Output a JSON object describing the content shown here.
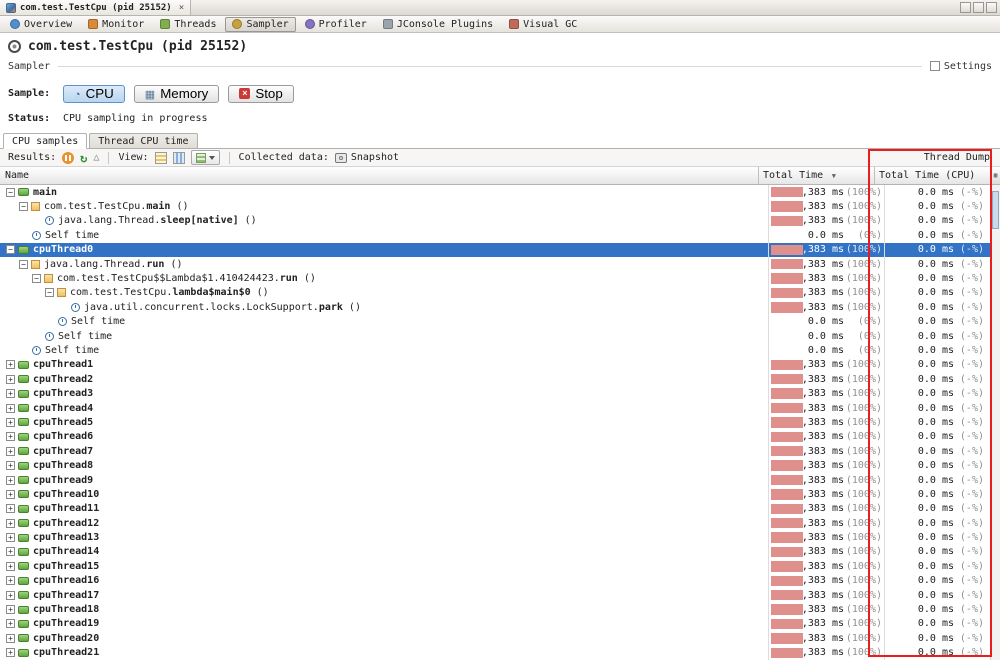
{
  "window": {
    "doc_tab_title": "com.test.TestCpu (pid 25152)",
    "close_symbol": "×"
  },
  "nav_tabs": [
    {
      "label": "Overview",
      "selected": false
    },
    {
      "label": "Monitor",
      "selected": false
    },
    {
      "label": "Threads",
      "selected": false
    },
    {
      "label": "Sampler",
      "selected": true
    },
    {
      "label": "Profiler",
      "selected": false
    },
    {
      "label": "JConsole Plugins",
      "selected": false
    },
    {
      "label": "Visual GC",
      "selected": false
    }
  ],
  "page": {
    "title": "com.test.TestCpu (pid 25152)",
    "section_label": "Sampler",
    "settings_label": "Settings",
    "sample_label": "Sample:",
    "cpu_button": "CPU",
    "memory_button": "Memory",
    "stop_button": "Stop",
    "status_label": "Status:",
    "status_value": "CPU sampling in progress"
  },
  "result_tabs": [
    {
      "label": "CPU samples",
      "selected": true
    },
    {
      "label": "Thread CPU time",
      "selected": false
    }
  ],
  "toolbar": {
    "results_label": "Results:",
    "view_label": "View:",
    "collected_label": "Collected data:",
    "snapshot_label": "Snapshot",
    "thread_dump_label": "Thread Dump",
    "sort_symbol": "▼"
  },
  "table": {
    "columns": {
      "name": "Name",
      "total": "Total Time",
      "cpu": "Total Time (CPU)"
    },
    "rows": [
      {
        "indent": 0,
        "handle": "minus",
        "icon": "thread",
        "prefix": "",
        "bold": "main",
        "suffix": "",
        "total_ms": "10,383 ms",
        "total_pct": "(100%)",
        "cpu_ms": "0.0 ms",
        "cpu_pct": "(-%)",
        "bar": 100,
        "selected": false
      },
      {
        "indent": 1,
        "handle": "minus",
        "icon": "method",
        "prefix": "com.test.TestCpu.",
        "bold": "main",
        "suffix": " ()",
        "total_ms": "10,383 ms",
        "total_pct": "(100%)",
        "cpu_ms": "0.0 ms",
        "cpu_pct": "(-%)",
        "bar": 100,
        "selected": false
      },
      {
        "indent": 3,
        "handle": "none",
        "icon": "clock",
        "prefix": "java.lang.Thread.",
        "bold": "sleep[native]",
        "suffix": " ()",
        "total_ms": "10,383 ms",
        "total_pct": "(100%)",
        "cpu_ms": "0.0 ms",
        "cpu_pct": "(-%)",
        "bar": 100,
        "selected": false
      },
      {
        "indent": 2,
        "handle": "none",
        "icon": "clock",
        "prefix": "Self time",
        "bold": "",
        "suffix": "",
        "total_ms": "0.0 ms",
        "total_pct": "(0%)",
        "cpu_ms": "0.0 ms",
        "cpu_pct": "(-%)",
        "bar": 0,
        "selected": false
      },
      {
        "indent": 0,
        "handle": "minus",
        "icon": "thread",
        "prefix": "",
        "bold": "cpuThread0",
        "suffix": "",
        "total_ms": "10,383 ms",
        "total_pct": "(100%)",
        "cpu_ms": "0.0 ms",
        "cpu_pct": "(-%)",
        "bar": 100,
        "selected": true
      },
      {
        "indent": 1,
        "handle": "minus",
        "icon": "method",
        "prefix": "java.lang.Thread.",
        "bold": "run",
        "suffix": " ()",
        "total_ms": "10,383 ms",
        "total_pct": "(100%)",
        "cpu_ms": "0.0 ms",
        "cpu_pct": "(-%)",
        "bar": 100,
        "selected": false
      },
      {
        "indent": 2,
        "handle": "minus",
        "icon": "method",
        "prefix": "com.test.TestCpu$$Lambda$1.410424423.",
        "bold": "run",
        "suffix": " ()",
        "total_ms": "10,383 ms",
        "total_pct": "(100%)",
        "cpu_ms": "0.0 ms",
        "cpu_pct": "(-%)",
        "bar": 100,
        "selected": false
      },
      {
        "indent": 3,
        "handle": "minus",
        "icon": "method",
        "prefix": "com.test.TestCpu.",
        "bold": "lambda$main$0",
        "suffix": " ()",
        "total_ms": "10,383 ms",
        "total_pct": "(100%)",
        "cpu_ms": "0.0 ms",
        "cpu_pct": "(-%)",
        "bar": 100,
        "selected": false
      },
      {
        "indent": 5,
        "handle": "none",
        "icon": "clock",
        "prefix": "java.util.concurrent.locks.LockSupport.",
        "bold": "park",
        "suffix": " ()",
        "total_ms": "10,383 ms",
        "total_pct": "(100%)",
        "cpu_ms": "0.0 ms",
        "cpu_pct": "(-%)",
        "bar": 100,
        "selected": false
      },
      {
        "indent": 4,
        "handle": "none",
        "icon": "clock",
        "prefix": "Self time",
        "bold": "",
        "suffix": "",
        "total_ms": "0.0 ms",
        "total_pct": "(0%)",
        "cpu_ms": "0.0 ms",
        "cpu_pct": "(-%)",
        "bar": 0,
        "selected": false
      },
      {
        "indent": 3,
        "handle": "none",
        "icon": "clock",
        "prefix": "Self time",
        "bold": "",
        "suffix": "",
        "total_ms": "0.0 ms",
        "total_pct": "(0%)",
        "cpu_ms": "0.0 ms",
        "cpu_pct": "(-%)",
        "bar": 0,
        "selected": false
      },
      {
        "indent": 2,
        "handle": "none",
        "icon": "clock",
        "prefix": "Self time",
        "bold": "",
        "suffix": "",
        "total_ms": "0.0 ms",
        "total_pct": "(0%)",
        "cpu_ms": "0.0 ms",
        "cpu_pct": "(-%)",
        "bar": 0,
        "selected": false
      },
      {
        "indent": 0,
        "handle": "plus",
        "icon": "thread",
        "prefix": "",
        "bold": "cpuThread1",
        "suffix": "",
        "total_ms": "10,383 ms",
        "total_pct": "(100%)",
        "cpu_ms": "0.0 ms",
        "cpu_pct": "(-%)",
        "bar": 100,
        "selected": false
      },
      {
        "indent": 0,
        "handle": "plus",
        "icon": "thread",
        "prefix": "",
        "bold": "cpuThread2",
        "suffix": "",
        "total_ms": "10,383 ms",
        "total_pct": "(100%)",
        "cpu_ms": "0.0 ms",
        "cpu_pct": "(-%)",
        "bar": 100,
        "selected": false
      },
      {
        "indent": 0,
        "handle": "plus",
        "icon": "thread",
        "prefix": "",
        "bold": "cpuThread3",
        "suffix": "",
        "total_ms": "10,383 ms",
        "total_pct": "(100%)",
        "cpu_ms": "0.0 ms",
        "cpu_pct": "(-%)",
        "bar": 100,
        "selected": false
      },
      {
        "indent": 0,
        "handle": "plus",
        "icon": "thread",
        "prefix": "",
        "bold": "cpuThread4",
        "suffix": "",
        "total_ms": "10,383 ms",
        "total_pct": "(100%)",
        "cpu_ms": "0.0 ms",
        "cpu_pct": "(-%)",
        "bar": 100,
        "selected": false
      },
      {
        "indent": 0,
        "handle": "plus",
        "icon": "thread",
        "prefix": "",
        "bold": "cpuThread5",
        "suffix": "",
        "total_ms": "10,383 ms",
        "total_pct": "(100%)",
        "cpu_ms": "0.0 ms",
        "cpu_pct": "(-%)",
        "bar": 100,
        "selected": false
      },
      {
        "indent": 0,
        "handle": "plus",
        "icon": "thread",
        "prefix": "",
        "bold": "cpuThread6",
        "suffix": "",
        "total_ms": "10,383 ms",
        "total_pct": "(100%)",
        "cpu_ms": "0.0 ms",
        "cpu_pct": "(-%)",
        "bar": 100,
        "selected": false
      },
      {
        "indent": 0,
        "handle": "plus",
        "icon": "thread",
        "prefix": "",
        "bold": "cpuThread7",
        "suffix": "",
        "total_ms": "10,383 ms",
        "total_pct": "(100%)",
        "cpu_ms": "0.0 ms",
        "cpu_pct": "(-%)",
        "bar": 100,
        "selected": false
      },
      {
        "indent": 0,
        "handle": "plus",
        "icon": "thread",
        "prefix": "",
        "bold": "cpuThread8",
        "suffix": "",
        "total_ms": "10,383 ms",
        "total_pct": "(100%)",
        "cpu_ms": "0.0 ms",
        "cpu_pct": "(-%)",
        "bar": 100,
        "selected": false
      },
      {
        "indent": 0,
        "handle": "plus",
        "icon": "thread",
        "prefix": "",
        "bold": "cpuThread9",
        "suffix": "",
        "total_ms": "10,383 ms",
        "total_pct": "(100%)",
        "cpu_ms": "0.0 ms",
        "cpu_pct": "(-%)",
        "bar": 100,
        "selected": false
      },
      {
        "indent": 0,
        "handle": "plus",
        "icon": "thread",
        "prefix": "",
        "bold": "cpuThread10",
        "suffix": "",
        "total_ms": "10,383 ms",
        "total_pct": "(100%)",
        "cpu_ms": "0.0 ms",
        "cpu_pct": "(-%)",
        "bar": 100,
        "selected": false
      },
      {
        "indent": 0,
        "handle": "plus",
        "icon": "thread",
        "prefix": "",
        "bold": "cpuThread11",
        "suffix": "",
        "total_ms": "10,383 ms",
        "total_pct": "(100%)",
        "cpu_ms": "0.0 ms",
        "cpu_pct": "(-%)",
        "bar": 100,
        "selected": false
      },
      {
        "indent": 0,
        "handle": "plus",
        "icon": "thread",
        "prefix": "",
        "bold": "cpuThread12",
        "suffix": "",
        "total_ms": "10,383 ms",
        "total_pct": "(100%)",
        "cpu_ms": "0.0 ms",
        "cpu_pct": "(-%)",
        "bar": 100,
        "selected": false
      },
      {
        "indent": 0,
        "handle": "plus",
        "icon": "thread",
        "prefix": "",
        "bold": "cpuThread13",
        "suffix": "",
        "total_ms": "10,383 ms",
        "total_pct": "(100%)",
        "cpu_ms": "0.0 ms",
        "cpu_pct": "(-%)",
        "bar": 100,
        "selected": false
      },
      {
        "indent": 0,
        "handle": "plus",
        "icon": "thread",
        "prefix": "",
        "bold": "cpuThread14",
        "suffix": "",
        "total_ms": "10,383 ms",
        "total_pct": "(100%)",
        "cpu_ms": "0.0 ms",
        "cpu_pct": "(-%)",
        "bar": 100,
        "selected": false
      },
      {
        "indent": 0,
        "handle": "plus",
        "icon": "thread",
        "prefix": "",
        "bold": "cpuThread15",
        "suffix": "",
        "total_ms": "10,383 ms",
        "total_pct": "(100%)",
        "cpu_ms": "0.0 ms",
        "cpu_pct": "(-%)",
        "bar": 100,
        "selected": false
      },
      {
        "indent": 0,
        "handle": "plus",
        "icon": "thread",
        "prefix": "",
        "bold": "cpuThread16",
        "suffix": "",
        "total_ms": "10,383 ms",
        "total_pct": "(100%)",
        "cpu_ms": "0.0 ms",
        "cpu_pct": "(-%)",
        "bar": 100,
        "selected": false
      },
      {
        "indent": 0,
        "handle": "plus",
        "icon": "thread",
        "prefix": "",
        "bold": "cpuThread17",
        "suffix": "",
        "total_ms": "10,383 ms",
        "total_pct": "(100%)",
        "cpu_ms": "0.0 ms",
        "cpu_pct": "(-%)",
        "bar": 100,
        "selected": false
      },
      {
        "indent": 0,
        "handle": "plus",
        "icon": "thread",
        "prefix": "",
        "bold": "cpuThread18",
        "suffix": "",
        "total_ms": "10,383 ms",
        "total_pct": "(100%)",
        "cpu_ms": "0.0 ms",
        "cpu_pct": "(-%)",
        "bar": 100,
        "selected": false
      },
      {
        "indent": 0,
        "handle": "plus",
        "icon": "thread",
        "prefix": "",
        "bold": "cpuThread19",
        "suffix": "",
        "total_ms": "10,383 ms",
        "total_pct": "(100%)",
        "cpu_ms": "0.0 ms",
        "cpu_pct": "(-%)",
        "bar": 100,
        "selected": false
      },
      {
        "indent": 0,
        "handle": "plus",
        "icon": "thread",
        "prefix": "",
        "bold": "cpuThread20",
        "suffix": "",
        "total_ms": "10,383 ms",
        "total_pct": "(100%)",
        "cpu_ms": "0.0 ms",
        "cpu_pct": "(-%)",
        "bar": 100,
        "selected": false
      },
      {
        "indent": 0,
        "handle": "plus",
        "icon": "thread",
        "prefix": "",
        "bold": "cpuThread21",
        "suffix": "",
        "total_ms": "10,383 ms",
        "total_pct": "(100%)",
        "cpu_ms": "0.0 ms",
        "cpu_pct": "(-%)",
        "bar": 100,
        "selected": false
      }
    ]
  },
  "colors": {
    "bar": "#e0908c",
    "selection": "#3273c5",
    "annotation": "#ea1c1c"
  }
}
